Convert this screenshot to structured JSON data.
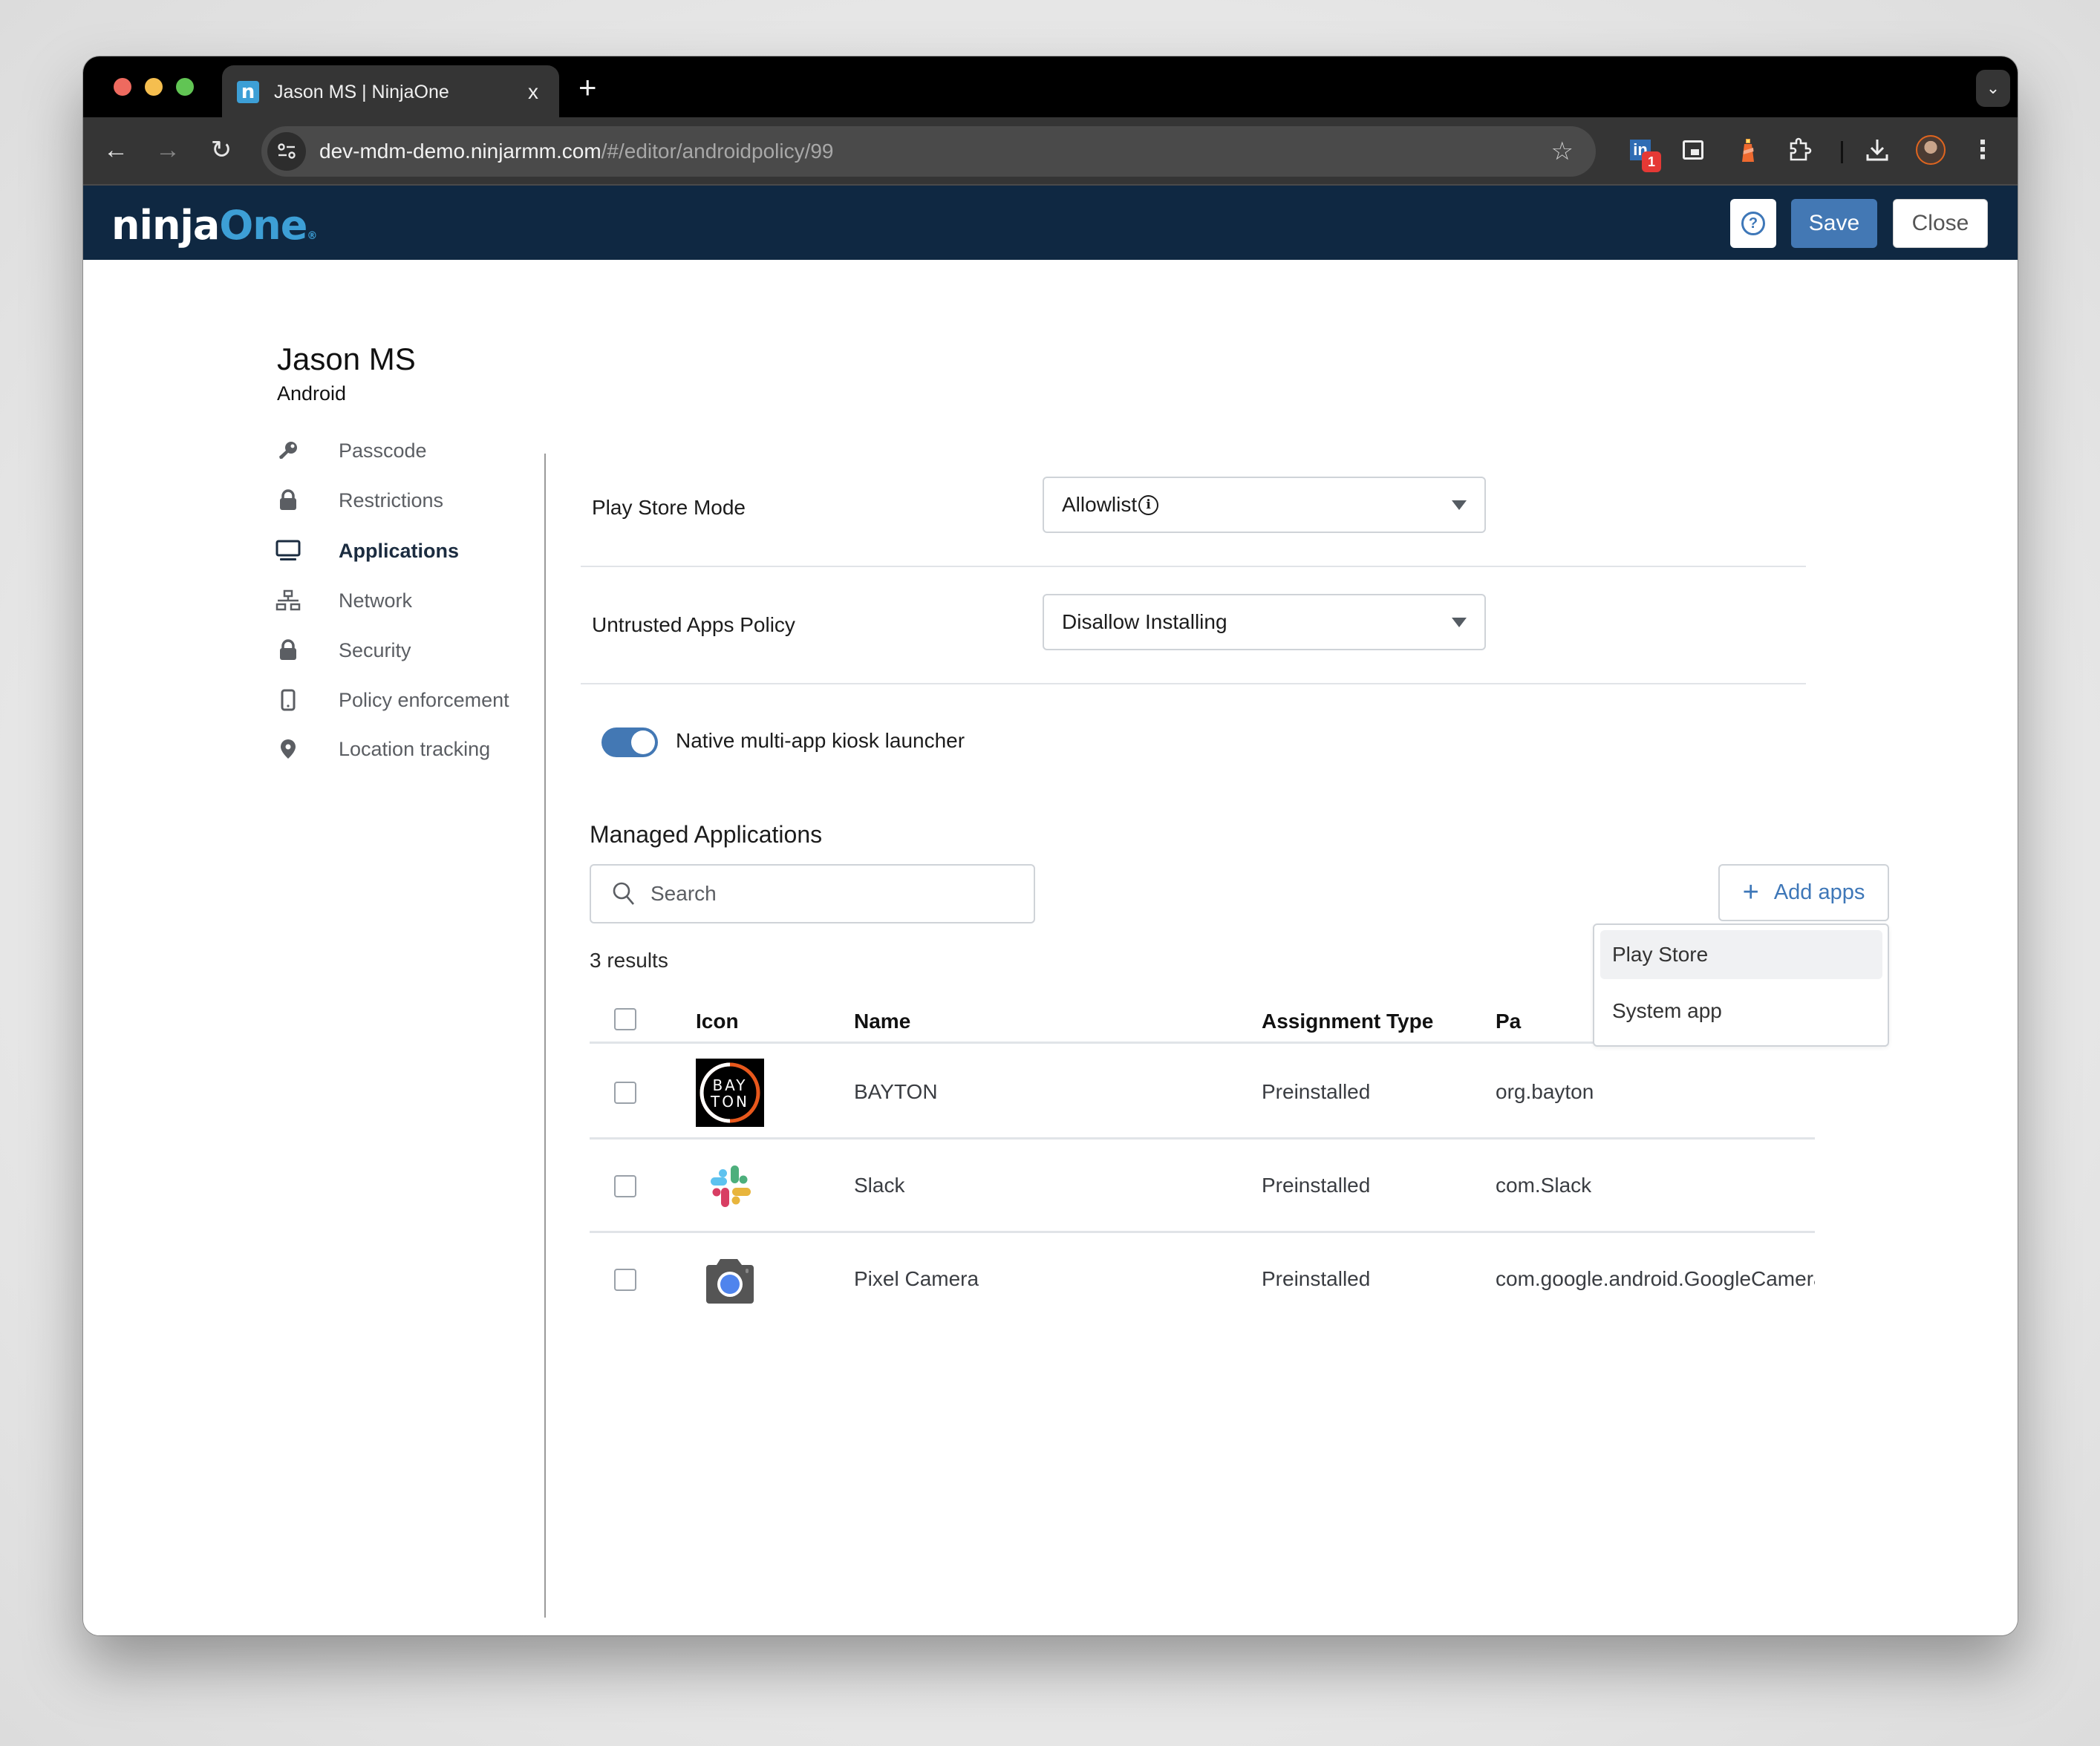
{
  "browser": {
    "tab_title": "Jason MS | NinjaOne",
    "tab_favicon_letter": "n",
    "tab_close": "x",
    "new_tab": "+",
    "url_host": "dev-mdm-demo.ninjarmm.com",
    "url_path": "/#/editor/androidpolicy/99",
    "extensions": [
      "linkedin-extension",
      "picture-in-picture-extension",
      "lighthouse-extension",
      "extensions-puzzle"
    ],
    "linkedin_badge": "1"
  },
  "header": {
    "logo_part1": "ninja",
    "logo_part2": "One",
    "help_label": "?",
    "save_label": "Save",
    "close_label": "Close",
    "brand_color": "#0f2842",
    "accent_color": "#4378b4"
  },
  "page": {
    "title": "Jason MS",
    "subtitle": "Android"
  },
  "sidebar": {
    "items": [
      {
        "label": "Passcode",
        "icon": "key-icon",
        "active": false
      },
      {
        "label": "Restrictions",
        "icon": "lock-icon",
        "active": false
      },
      {
        "label": "Applications",
        "icon": "monitor-icon",
        "active": true
      },
      {
        "label": "Network",
        "icon": "network-icon",
        "active": false
      },
      {
        "label": "Security",
        "icon": "lock-icon",
        "active": false
      },
      {
        "label": "Policy enforcement",
        "icon": "mobile-icon",
        "active": false
      },
      {
        "label": "Location tracking",
        "icon": "map-pin-icon",
        "active": false
      }
    ]
  },
  "settings": {
    "play_store_mode": {
      "label": "Play Store Mode",
      "value": "Allowlist",
      "info_icon": "i"
    },
    "untrusted_apps_policy": {
      "label": "Untrusted Apps Policy",
      "value": "Disallow Installing"
    },
    "kiosk_launcher": {
      "label": "Native multi-app kiosk launcher",
      "enabled": true
    }
  },
  "managed_apps": {
    "title": "Managed Applications",
    "search_placeholder": "Search",
    "search_value": "",
    "add_apps_label": "Add apps",
    "results_text": "3 results",
    "add_menu": {
      "items": [
        {
          "label": "Play Store",
          "highlighted": true
        },
        {
          "label": "System app",
          "highlighted": false
        }
      ]
    },
    "columns": [
      "Icon",
      "Name",
      "Assignment Type",
      "Pa"
    ],
    "rows": [
      {
        "icon": "bayton-logo-icon",
        "icon_text_top": "BAY",
        "icon_text_bottom": "TON",
        "name": "BAYTON",
        "assignment_type": "Preinstalled",
        "package": "org.bayton",
        "checked": false
      },
      {
        "icon": "slack-logo-icon",
        "name": "Slack",
        "assignment_type": "Preinstalled",
        "package": "com.Slack",
        "checked": false
      },
      {
        "icon": "pixel-camera-icon",
        "name": "Pixel Camera",
        "assignment_type": "Preinstalled",
        "package": "com.google.android.GoogleCamera",
        "checked": false
      }
    ]
  }
}
